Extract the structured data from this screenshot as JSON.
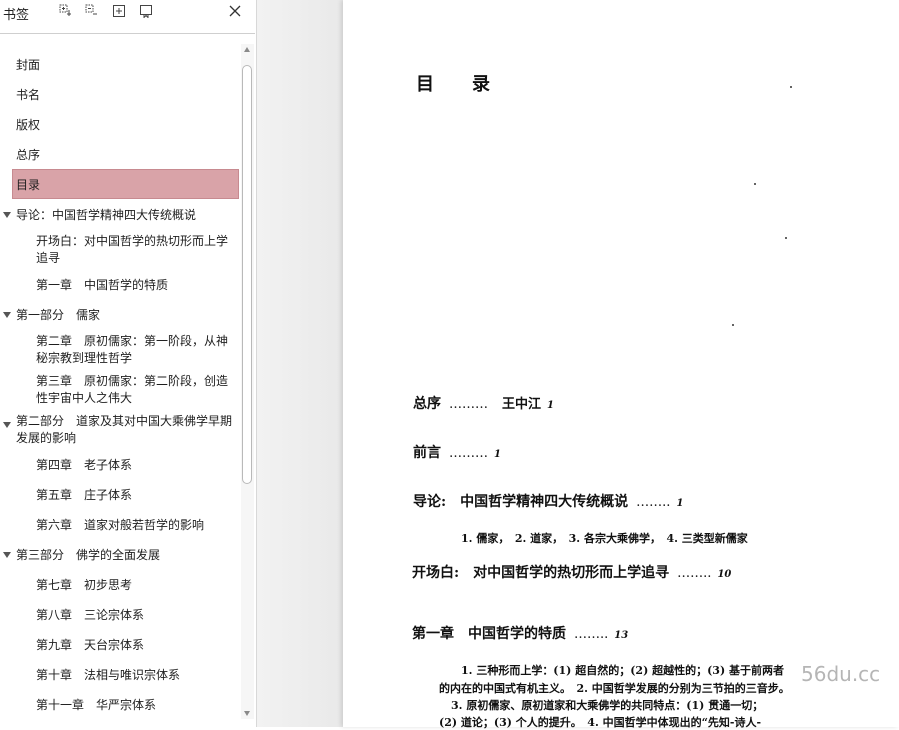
{
  "sidebar": {
    "title": "书签",
    "toolbar_icons": [
      "expand-all-icon",
      "collapse-all-icon",
      "add-bookmark-icon",
      "bookmark-icon",
      "close-icon"
    ],
    "items": [
      {
        "label": "封面",
        "level": 0,
        "expanded": null,
        "selected": false
      },
      {
        "label": "书名",
        "level": 0,
        "expanded": null,
        "selected": false
      },
      {
        "label": "版权",
        "level": 0,
        "expanded": null,
        "selected": false
      },
      {
        "label": "总序",
        "level": 0,
        "expanded": null,
        "selected": false
      },
      {
        "label": "目录",
        "level": 0,
        "expanded": null,
        "selected": true
      },
      {
        "label": "导论：中国哲学精神四大传统概说",
        "level": 0,
        "expanded": true,
        "selected": false
      },
      {
        "label": "开场白：对中国哲学的热切形而上学追寻",
        "level": 1,
        "expanded": null,
        "selected": false
      },
      {
        "label": "第一章　中国哲学的特质",
        "level": 1,
        "expanded": null,
        "selected": false
      },
      {
        "label": "第一部分　儒家",
        "level": 0,
        "expanded": true,
        "selected": false
      },
      {
        "label": "第二章　原初儒家：第一阶段，从神秘宗教到理性哲学",
        "level": 1,
        "expanded": null,
        "selected": false
      },
      {
        "label": "第三章　原初儒家：第二阶段，创造性宇宙中人之伟大",
        "level": 1,
        "expanded": null,
        "selected": false
      },
      {
        "label": "第二部分　道家及其对中国大乘佛学早期发展的影响",
        "level": 0,
        "expanded": true,
        "selected": false
      },
      {
        "label": "第四章　老子体系",
        "level": 1,
        "expanded": null,
        "selected": false
      },
      {
        "label": "第五章　庄子体系",
        "level": 1,
        "expanded": null,
        "selected": false
      },
      {
        "label": "第六章　道家对般若哲学的影响",
        "level": 1,
        "expanded": null,
        "selected": false
      },
      {
        "label": "第三部分　佛学的全面发展",
        "level": 0,
        "expanded": true,
        "selected": false
      },
      {
        "label": "第七章　初步思考",
        "level": 1,
        "expanded": null,
        "selected": false
      },
      {
        "label": "第八章　三论宗体系",
        "level": 1,
        "expanded": null,
        "selected": false
      },
      {
        "label": "第九章　天台宗体系",
        "level": 1,
        "expanded": null,
        "selected": false
      },
      {
        "label": "第十章　法相与唯识宗体系",
        "level": 1,
        "expanded": null,
        "selected": false
      },
      {
        "label": "第十一章　华严宗体系",
        "level": 1,
        "expanded": null,
        "selected": false
      }
    ],
    "selected_color": "#d9a3a8"
  },
  "page": {
    "title": "目　录",
    "entries": [
      {
        "label": "总序",
        "dots": "………",
        "author": "王中江",
        "page": "1"
      },
      {
        "label": "前言",
        "dots": "………",
        "author": "",
        "page": "1"
      },
      {
        "label": "导论:　中国哲学精神四大传统概说",
        "dots": "……..",
        "author": "",
        "page": "1"
      },
      {
        "label": "开场白:　对中国哲学的热切形而上学追寻",
        "dots": "……..",
        "author": "",
        "page": "10"
      },
      {
        "label": "第一章　中国哲学的特质",
        "dots": "……..",
        "author": "",
        "page": "13"
      }
    ],
    "intro_sub": "1. 儒家，　2. 道家，　3. 各宗大乘佛学，　4. 三类型新儒家",
    "ch1_sub_lines": [
      "1. 三种形而上学：(1) 超自然的；(2) 超越性的；(3) 基于前两者",
      "的内在的中国式有机主义。　2. 中国哲学发展的分别为三节拍的三音步。",
      "3. 原初儒家、原初道家和大乘佛学的共同特点：(1) 贯通一切；",
      "(2) 道论；(3) 个人的提升。　4. 中国哲学中体现出的“先知-诗人-"
    ],
    "watermark": "56du.cc"
  }
}
